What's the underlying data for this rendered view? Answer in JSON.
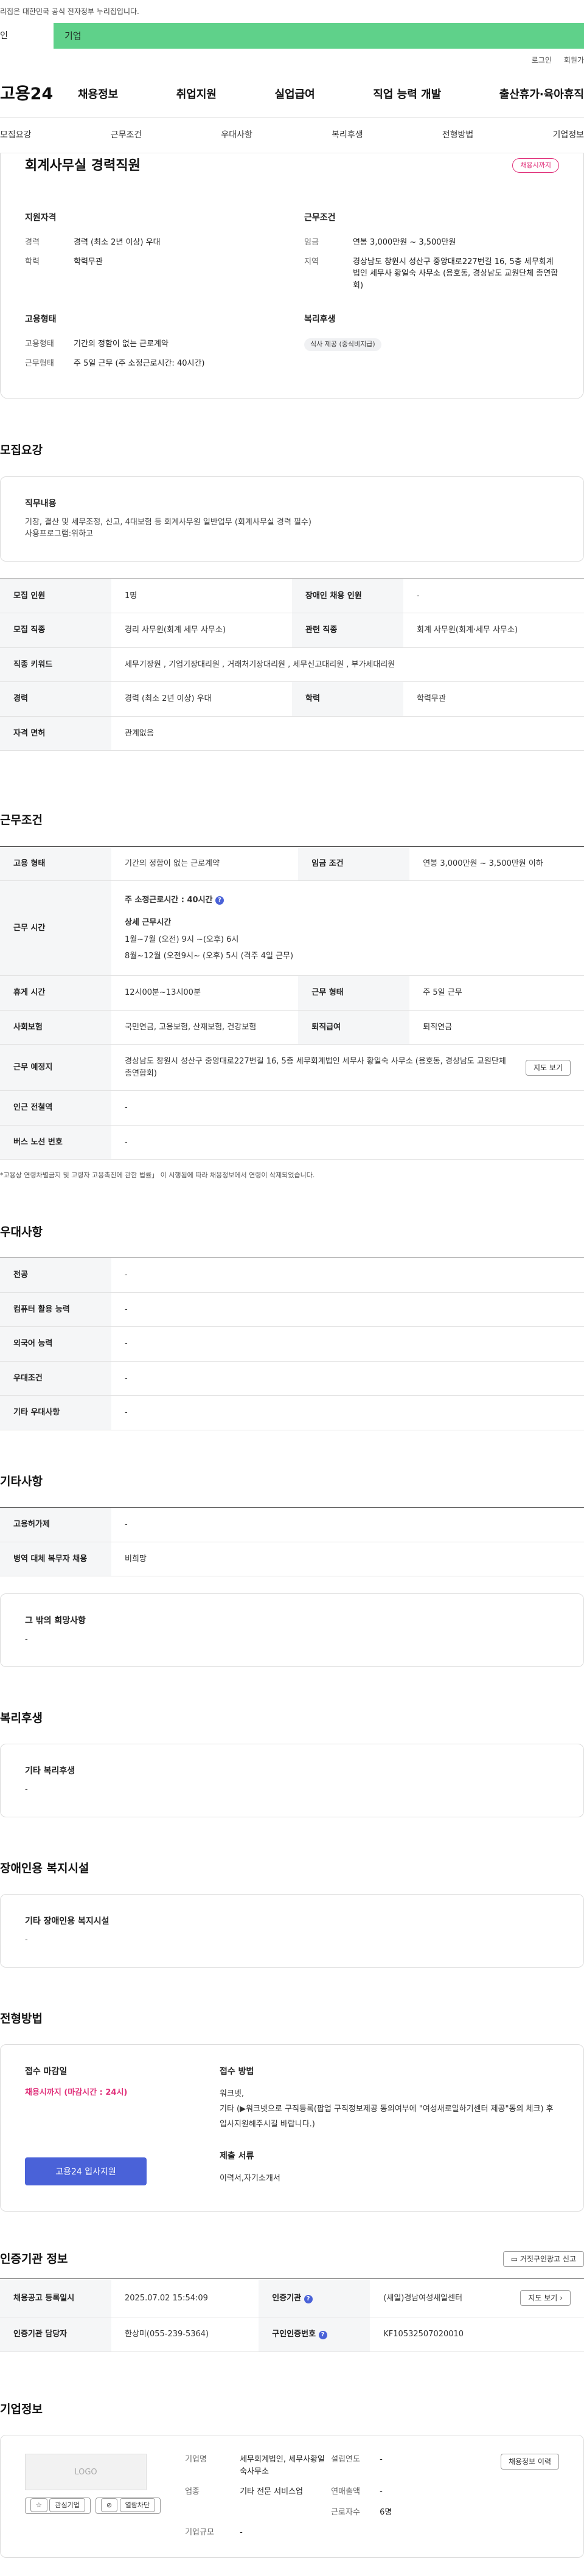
{
  "header": {
    "gov_notice": "리집은 대한민국 공식 전자정부 누리집입니다.",
    "tab_person": "인",
    "tab_company": "기업",
    "util_login": "로그인",
    "util_join": "회원가",
    "logo": "고용24",
    "menu": [
      "채용정보",
      "취업지원",
      "실업급여",
      "직업 능력 개발",
      "출산휴가·육아휴직"
    ],
    "subnav": [
      "모집요강",
      "근무조건",
      "우대사항",
      "복리후생",
      "전형방법",
      "기업정보"
    ]
  },
  "summary": {
    "title": "회계사무실 경력직원",
    "badge": "채용시까지",
    "qualification_heading": "지원자격",
    "qualification": [
      {
        "k": "경력",
        "v": "경력 (최소 2년 이상) 우대"
      },
      {
        "k": "학력",
        "v": "학력무관"
      }
    ],
    "conditions_heading": "근무조건",
    "conditions": [
      {
        "k": "임금",
        "v": "연봉 3,000만원 ~ 3,500만원"
      },
      {
        "k": "지역",
        "v": "경상남도 창원시 성산구 중앙대로227번길 16, 5층 세무회계법인 세무사 황일숙 사무소 (용호동, 경상남도 교원단체 총연합회)"
      }
    ],
    "employment_heading": "고용형태",
    "employment": [
      {
        "k": "고용형태",
        "v": "기간의 정함이 없는 근로계약"
      },
      {
        "k": "근무형태",
        "v": "주 5일 근무 (주 소정근로시간: 40시간)"
      }
    ],
    "welfare_heading": "복리후생",
    "welfare_chip": "식사 제공 (중식비지급)"
  },
  "recruit": {
    "title": "모집요강",
    "duty_heading": "직무내용",
    "duty_lines": [
      "기장, 결산 및 세무조정, 신고, 4대보험 등 회계사무원 일반업무 (회계사무실 경력 필수)",
      "사용프로그램:위하고"
    ],
    "rows": [
      {
        "k1": "모집 인원",
        "v1": "1명",
        "k2": "장애인 채용 인원",
        "v2": "-"
      },
      {
        "k1": "모집 직종",
        "v1": "경리 사무원(회계 세무 사무소)",
        "k2": "관련 직종",
        "v2": "회계 사무원(회계·세무 사무소)"
      }
    ],
    "keyword_k": "직종 키워드",
    "keyword_v": "세무기장원 , 기업기장대리원 , 거래처기장대리원 , 세무신고대리원 , 부가세대리원",
    "exp_k": "경력",
    "exp_v": "경력 (최소 2년 이상) 우대",
    "edu_k": "학력",
    "edu_v": "학력무관",
    "license_k": "자격 면허",
    "license_v": "관계없음"
  },
  "work": {
    "title": "근무조건",
    "type_k": "고용 형태",
    "type_v": "기간의 정함이 없는 근로계약",
    "wage_k": "임금 조건",
    "wage_v": "연봉 3,000만원 ~ 3,500만원 이하",
    "hours_k": "근무 시간",
    "hours_main": "주 소정근로시간 : 40시간",
    "hours_detail_heading": "상세 근무시간",
    "hours_line1": "1월~7월 (오전) 9시 ~(오후) 6시",
    "hours_line2": "8월~12월 (오전9시~ (오후) 5시 (격주 4일 근무)",
    "break_k": "휴게 시간",
    "break_v": "12시00분~13시00분",
    "worktype_k": "근무 형태",
    "worktype_v": "주 5일 근무",
    "insurance_k": "사회보험",
    "insurance_v": "국민연금, 고용보험, 산재보험, 건강보험",
    "retire_k": "퇴직급여",
    "retire_v": "퇴직연금",
    "place_k": "근무 예정지",
    "place_v": "경상남도 창원시 성산구 중앙대로227번길 16, 5층 세무회계법인 세무사 황일숙 사무소 (용호동, 경상남도 교원단체 총연합회)",
    "map_btn": "지도 보기",
    "subway_k": "인근 전철역",
    "subway_v": "-",
    "bus_k": "버스 노선 번호",
    "bus_v": "-",
    "note": "*고용상 연령차별금지 및 고령자 고용촉진에 관한 법률」 이 시행됨에 따라 채용정보에서 연령이 삭제되었습니다."
  },
  "prefer": {
    "title": "우대사항",
    "rows": [
      {
        "k": "전공",
        "v": "-"
      },
      {
        "k": "컴퓨터 활용 능력",
        "v": "-"
      },
      {
        "k": "외국어 능력",
        "v": "-"
      },
      {
        "k": "우대조건",
        "v": "-"
      },
      {
        "k": "기타 우대사항",
        "v": "-"
      }
    ]
  },
  "etc": {
    "title": "기타사항",
    "rows": [
      {
        "k": "고용허가제",
        "v": "-"
      },
      {
        "k": "병역 대체 복무자 채용",
        "v": "비희망"
      }
    ],
    "hope_heading": "그 밖의 희망사항",
    "hope_value": "-"
  },
  "welfare": {
    "title": "복리후생",
    "box_heading": "기타 복리후생",
    "box_value": "-"
  },
  "disabled": {
    "title": "장애인용 복지시설",
    "box_heading": "기타 장애인용 복지시설",
    "box_value": "-"
  },
  "apply": {
    "title": "전형방법",
    "deadline_heading": "접수 마감일",
    "deadline_value": "채용시까지 (마감시간 : 24시)",
    "apply_button": "고용24 입사지원",
    "method_heading": "접수 방법",
    "method_lines": [
      "워크넷,",
      "기타 (▶워크넷으로 구직등록(팝업 구직정보제공 동의여부에 \"여성새로일하기센터 제공\"동의 체크) 후 입사지원해주시길 바랍니다.)"
    ],
    "docs_heading": "제출 서류",
    "docs_value": "이력서,자기소개서"
  },
  "agency": {
    "title": "인증기관 정보",
    "report_btn": "거짓구인광고 신고",
    "rows": [
      {
        "k1": "채용공고 등록일시",
        "v1": "2025.07.02 15:54:09",
        "k2": "인증기관",
        "v2": "(새일)경남여성새일센터"
      },
      {
        "k1": "인증기관 담당자",
        "v1": "한상미(055-239-5364)",
        "k2": "구인인증번호",
        "v2": "KF10532507020010"
      }
    ],
    "map_btn": "지도 보기"
  },
  "company": {
    "title": "기업정보",
    "logo_text": "LOGO",
    "fav_btn": "관심기업",
    "block_btn": "열람차단",
    "history_btn": "채용정보 이력",
    "fields": [
      {
        "k": "기업명",
        "v": "세무회계법인, 세무사황일숙사무소",
        "k2": "설립연도",
        "v2": "-"
      },
      {
        "k": "업종",
        "v": "기타 전문 서비스업",
        "k2": "연매출액",
        "v2": "-"
      },
      {
        "k": "",
        "v": "",
        "k2": "근로자수",
        "v2": "6명"
      },
      {
        "k": "기업규모",
        "v": "-",
        "k2": "",
        "v2": ""
      }
    ]
  },
  "colors": {
    "accent_green": "#5fd18a",
    "apply_blue": "#4a62d8",
    "badge_pink": "#e0307a"
  }
}
